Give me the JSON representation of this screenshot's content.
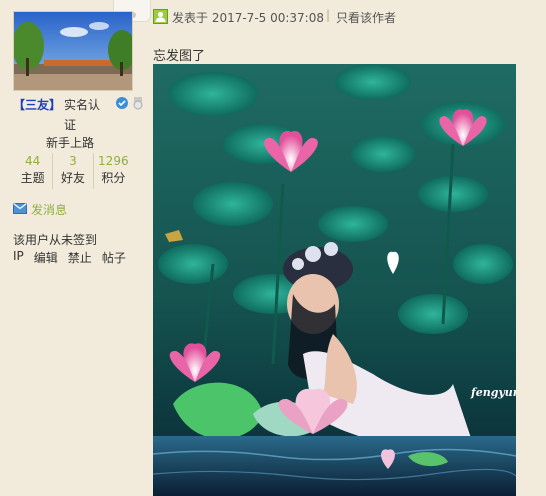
{
  "user": {
    "name": "【三友】",
    "verify_line1": "实名认",
    "verify_line2": "证",
    "rank": "新手上路",
    "stats": [
      {
        "num": "44",
        "label": "主题"
      },
      {
        "num": "3",
        "label": "好友"
      },
      {
        "num": "1296",
        "label": "积分"
      }
    ],
    "send_message": "发消息",
    "sign_note": "该用户从未签到",
    "admin_links": [
      "IP",
      "编辑",
      "禁止",
      "帖子"
    ]
  },
  "post": {
    "posted_on": "发表于 2017-7-5 00:37:08",
    "separator": "|",
    "only_author": "只看该作者",
    "text": "忘发图了",
    "watermark": "fengyun"
  },
  "colors": {
    "background": "#f2ebdb",
    "username": "#1b3fbf",
    "accent_green": "#8fae43"
  }
}
